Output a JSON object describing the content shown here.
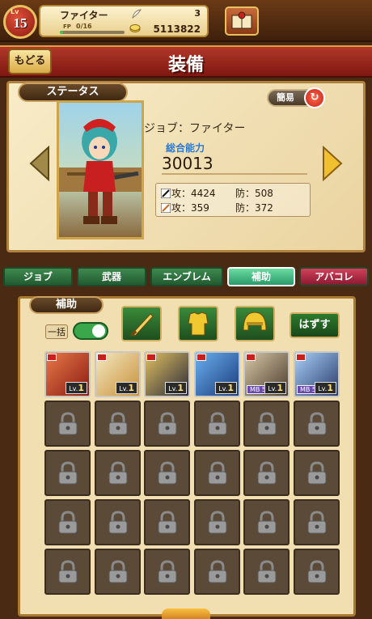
{
  "player": {
    "level_prefix": "Lv",
    "level": "15",
    "name": "ファイター",
    "fp_label": "FP",
    "fp_value": "0/16",
    "fp_progress": 0.05,
    "gems": "3",
    "gold": "5113822"
  },
  "header": {
    "title": "装備",
    "back_label": "もどる"
  },
  "status": {
    "section_label": "ステータス",
    "simple_label": "簡易",
    "job_text": "ジョブ：ファイター",
    "power_label": "総合能力",
    "power_value": "30013",
    "phys_atk": "攻：4424",
    "phys_def": "防：508",
    "mag_atk": "攻：359",
    "mag_def": "防：372"
  },
  "tabs": [
    {
      "label": "ジョブ",
      "active": false
    },
    {
      "label": "武器",
      "active": false
    },
    {
      "label": "エンブレム",
      "active": false
    },
    {
      "label": "補助",
      "active": true
    },
    {
      "label": "アバコレ",
      "active": false
    }
  ],
  "support": {
    "section_label": "補助",
    "bulk_label": "一括",
    "remove_label": "はずす",
    "filters": [
      "sword-icon",
      "armor-icon",
      "helmet-icon"
    ]
  },
  "cards": [
    {
      "lv_prefix": "Lv.",
      "lv": "1",
      "mb": "",
      "colors": [
        "#e87a4a",
        "#8a1a10"
      ]
    },
    {
      "lv_prefix": "Lv.",
      "lv": "1",
      "mb": "",
      "colors": [
        "#f4e8c0",
        "#c8903a"
      ]
    },
    {
      "lv_prefix": "Lv.",
      "lv": "1",
      "mb": "",
      "colors": [
        "#e0c060",
        "#2a2a3a"
      ]
    },
    {
      "lv_prefix": "Lv.",
      "lv": "1",
      "mb": "",
      "colors": [
        "#6ab0f0",
        "#1a3a7a"
      ]
    },
    {
      "lv_prefix": "Lv.",
      "lv": "1",
      "mb": "MB 5",
      "colors": [
        "#d8c8a8",
        "#4a3a2a"
      ]
    },
    {
      "lv_prefix": "Lv.",
      "lv": "1",
      "mb": "MB 5",
      "colors": [
        "#a8d0f8",
        "#2a3a6a"
      ]
    }
  ]
}
